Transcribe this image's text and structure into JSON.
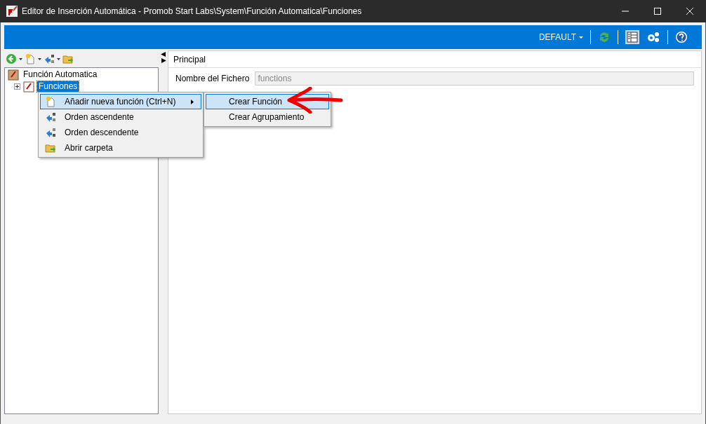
{
  "window": {
    "title": "Editor de Inserción Automática - Promob Start Labs\\System\\Función Automatica\\Funciones"
  },
  "header": {
    "profile": "DEFAULT"
  },
  "tree": [
    {
      "label": "Función Automatica",
      "expanded": true,
      "selected": false,
      "children": [
        {
          "label": "Funciones",
          "expanded": false,
          "selected": true
        }
      ]
    }
  ],
  "context_menu": {
    "items": [
      {
        "label": "Añadir nueva función (Ctrl+N)",
        "has_submenu": true,
        "selected": true
      },
      {
        "label": "Orden ascendente",
        "has_submenu": false,
        "selected": false
      },
      {
        "label": "Orden descendente",
        "has_submenu": false,
        "selected": false
      },
      {
        "label": "Abrir carpeta",
        "has_submenu": false,
        "selected": false
      }
    ]
  },
  "submenu": {
    "items": [
      {
        "label": "Crear Función",
        "selected": true
      },
      {
        "label": "Crear Agrupamiento",
        "selected": false
      }
    ]
  },
  "panel": {
    "title": "Principal",
    "fields": [
      {
        "label": "Nombre del Fichero",
        "value": "functions",
        "disabled": true
      }
    ]
  }
}
